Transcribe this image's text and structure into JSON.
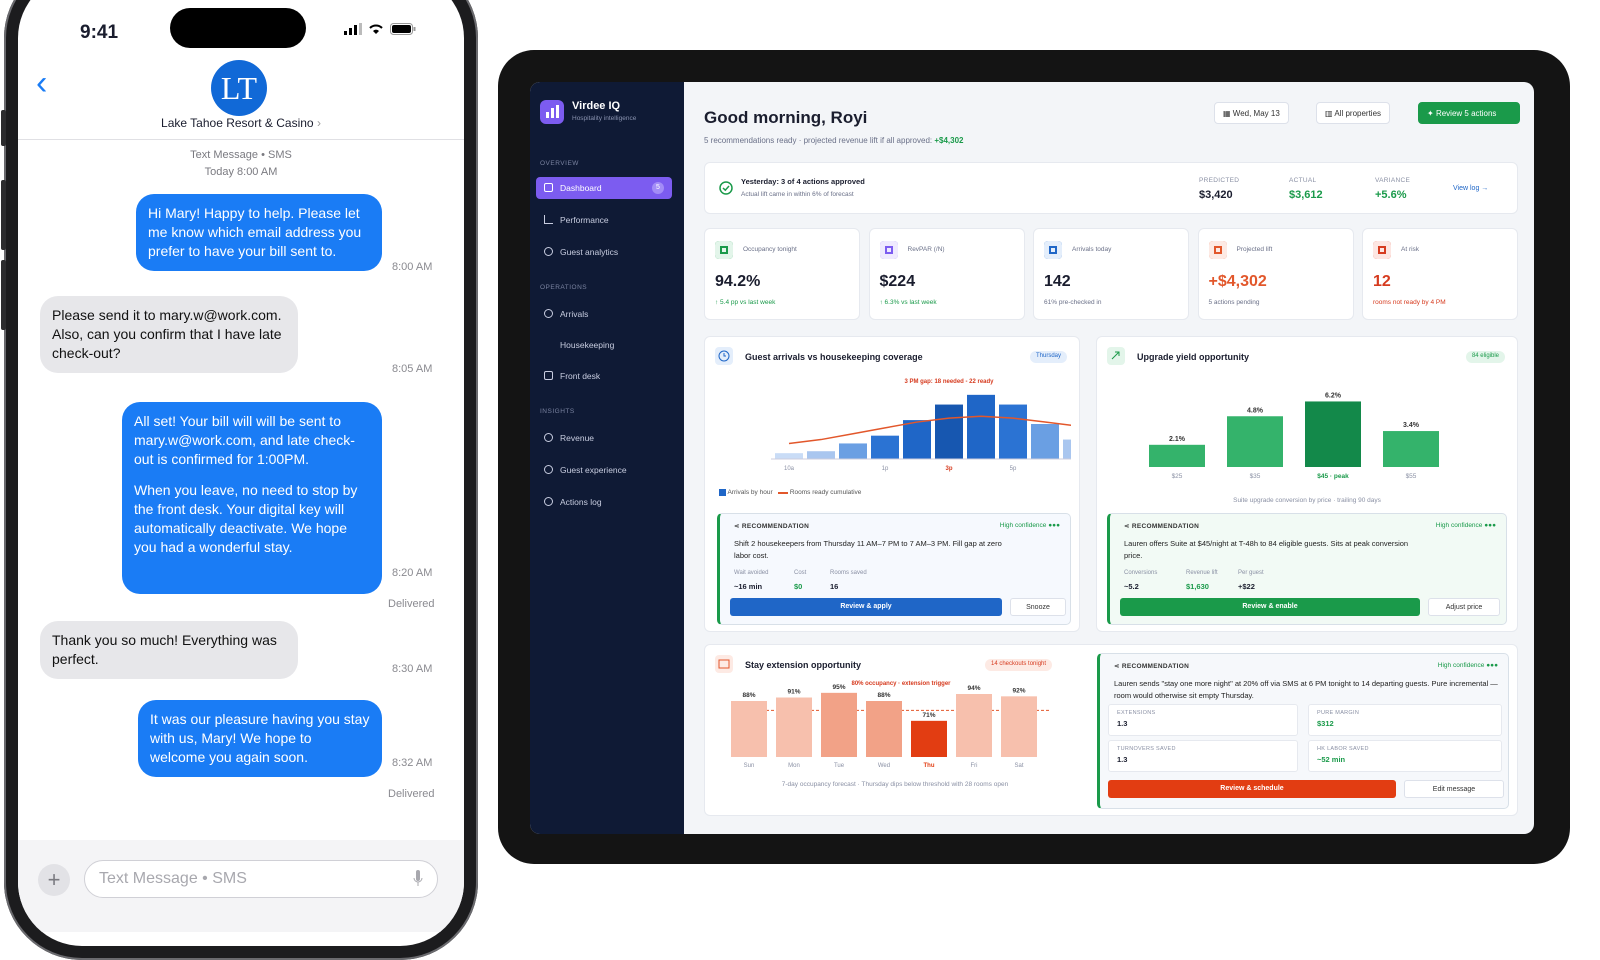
{
  "phone": {
    "time": "9:41",
    "contact_initials": "LT",
    "contact_name": "Lake Tahoe Resort & Casino",
    "channel": "Text Message • SMS",
    "day": "Today 8:00 AM",
    "messages": [
      {
        "dir": "out",
        "text": "Hi Mary! Happy to help. Please let me know which email address you prefer to have your bill sent to.",
        "time": "8:00 AM"
      },
      {
        "dir": "in",
        "text": "Please send it to mary.w@work.com. Also, can you confirm that I have late check-out?",
        "time": "8:05 AM"
      },
      {
        "dir": "out",
        "text": "All set! Your bill will will be sent to mary.w@work.com, and late check-out is confirmed for 1:00PM.",
        "text2": "When you leave, no need to stop by the front desk. Your digital key will automatically deactivate. We hope you had a wonderful stay.",
        "time": "8:20 AM",
        "status": "Delivered"
      },
      {
        "dir": "in",
        "text": "Thank you so much! Everything was perfect.",
        "time": "8:30 AM"
      },
      {
        "dir": "out",
        "text": "It was our pleasure having you stay with us, Mary! We hope to welcome you again soon.",
        "time": "8:32 AM",
        "status": "Delivered"
      }
    ],
    "composer_placeholder": "Text Message • SMS"
  },
  "app": {
    "name": "Virdee IQ",
    "tagline": "Hospitality intelligence",
    "accent": "#7c5cf0",
    "sidebar": {
      "sections": [
        {
          "title": "OVERVIEW",
          "items": [
            {
              "label": "Dashboard",
              "badge": "5",
              "active": true
            },
            {
              "label": "Performance"
            },
            {
              "label": "Guest analytics"
            }
          ]
        },
        {
          "title": "OPERATIONS",
          "items": [
            {
              "label": "Arrivals"
            },
            {
              "label": "Housekeeping"
            },
            {
              "label": "Front desk"
            }
          ]
        },
        {
          "title": "INSIGHTS",
          "items": [
            {
              "label": "Revenue"
            },
            {
              "label": "Guest experience"
            },
            {
              "label": "Actions log"
            }
          ]
        }
      ]
    },
    "header": {
      "greeting": "Good morning, Royi",
      "subtitle": "5 recommendations ready · projected revenue lift if all approved:",
      "subtitle_value": "+$4,302",
      "date_btn": "Wed, May 13",
      "property_btn": "All properties",
      "review_btn": "Review 5 actions"
    },
    "yesterday": {
      "title": "Yesterday: 3 of 4 actions approved",
      "note": "Actual lift came in within 6% of forecast",
      "predicted_label": "PREDICTED",
      "predicted": "$3,420",
      "actual_label": "ACTUAL",
      "actual": "$3,612",
      "variance_label": "VARIANCE",
      "variance": "+5.6%",
      "link": "View log →"
    },
    "kpis": [
      {
        "label": "Occupancy tonight",
        "value": "94.2%",
        "delta": "↑ 5.4 pp vs last week",
        "color": "#1a9a4a",
        "icon_bg": "#e3f5ea"
      },
      {
        "label": "RevPAR (/N)",
        "value": "$224",
        "delta": "↑ 6.3% vs last week",
        "color": "#7c5cf0",
        "icon_bg": "#efeafe"
      },
      {
        "label": "Arrivals today",
        "value": "142",
        "delta": "61% pre-checked in",
        "color": "#1f66c7",
        "icon_bg": "#e4eefb"
      },
      {
        "label": "Projected lift",
        "value": "+$4,302",
        "delta": "5 actions pending",
        "color": "#e2572b",
        "icon_bg": "#fdeae4"
      },
      {
        "label": "At risk",
        "value": "12",
        "delta": "rooms not ready by 4 PM",
        "color": "#d63b1f",
        "icon_bg": "#fde6e2"
      }
    ],
    "arrivals_card": {
      "title": "Guest arrivals vs housekeeping coverage",
      "pill": "Thursday",
      "gap_note": "3 PM gap: 18 needed - 22 ready",
      "legend_bars": "Arrivals by hour",
      "legend_line": "Rooms ready cumulative",
      "rec_header": "RECOMMENDATION",
      "rec_conf": "High confidence ●●●",
      "rec_text": "Shift 2 housekeepers from Thursday 11 AM–7 PM to 7 AM–3 PM. Fill gap at zero labor cost.",
      "metrics": [
        {
          "k": "Wait avoided",
          "v": "~16 min"
        },
        {
          "k": "Cost",
          "v": "$0"
        },
        {
          "k": "Rooms saved",
          "v": "16"
        }
      ],
      "primary": "Review & apply",
      "secondary": "Snooze"
    },
    "upgrade_card": {
      "title": "Upgrade yield opportunity",
      "pill": "84 eligible",
      "caption": "Suite upgrade conversion by price · trailing 90 days",
      "rec_header": "RECOMMENDATION",
      "rec_conf": "High confidence ●●●",
      "rec_text": "Lauren offers Suite at $45/night at T-48h to 84 eligible guests. Sits at peak conversion price.",
      "metrics": [
        {
          "k": "Conversions",
          "v": "~5.2"
        },
        {
          "k": "Revenue lift",
          "v": "$1,630"
        },
        {
          "k": "Per guest",
          "v": "+$22"
        }
      ],
      "primary": "Review & enable",
      "secondary": "Adjust price"
    },
    "stay_card": {
      "title": "Stay extension opportunity",
      "pill": "14 checkouts tonight",
      "threshold_note": "80% occupancy · extension trigger",
      "caption": "7-day occupancy forecast · Thursday dips below threshold with 28 rooms open",
      "rec_header": "RECOMMENDATION",
      "rec_conf": "High confidence ●●●",
      "rec_text": "Lauren sends \"stay one more night\" at 20% off via SMS at 6 PM tonight to 14 departing guests. Pure incremental — room would otherwise sit empty Thursday.",
      "tiles": [
        {
          "k": "EXTENSIONS",
          "v": "1.3"
        },
        {
          "k": "PURE MARGIN",
          "v": "$312"
        },
        {
          "k": "TURNOVERS SAVED",
          "v": "1.3"
        },
        {
          "k": "HK LABOR SAVED",
          "v": "~52 min"
        }
      ],
      "primary": "Review & schedule",
      "secondary": "Edit message"
    }
  },
  "chart_data": [
    {
      "type": "bar",
      "title": "Guest arrivals vs housekeeping coverage",
      "categories": [
        "10a",
        "11a",
        "12p",
        "1p",
        "2p",
        "3p",
        "4p",
        "5p",
        "6p",
        "7p",
        "8p"
      ],
      "tick_labels": [
        "10a",
        "1p",
        "3p",
        "5p",
        "8p"
      ],
      "series": [
        {
          "name": "Arrivals by hour",
          "type": "bar",
          "values": [
            3,
            4,
            8,
            12,
            20,
            28,
            33,
            28,
            18,
            10,
            5
          ]
        },
        {
          "name": "Rooms ready cumulative",
          "type": "line",
          "values": [
            8,
            10,
            13,
            16,
            19,
            21,
            22,
            21,
            19,
            17,
            15
          ]
        }
      ],
      "ylim": [
        0,
        36
      ]
    },
    {
      "type": "bar",
      "title": "Upgrade yield opportunity",
      "categories": [
        "$25",
        "$35",
        "$45 · peak",
        "$55"
      ],
      "values": [
        2.1,
        4.8,
        6.2,
        3.4
      ],
      "value_labels": [
        "2.1%",
        "4.8%",
        "6.2%",
        "3.4%"
      ],
      "ylim": [
        0,
        7
      ]
    },
    {
      "type": "bar",
      "title": "Stay extension opportunity",
      "categories": [
        "Sun",
        "Mon",
        "Tue",
        "Wed",
        "Thu",
        "Fri",
        "Sat"
      ],
      "values": [
        88,
        91,
        95,
        88,
        71,
        94,
        92
      ],
      "value_labels": [
        "88%",
        "91%",
        "95%",
        "88%",
        "71%",
        "94%",
        "92%"
      ],
      "threshold": 80,
      "highlight": "Thu",
      "ylim": [
        40,
        100
      ]
    }
  ]
}
